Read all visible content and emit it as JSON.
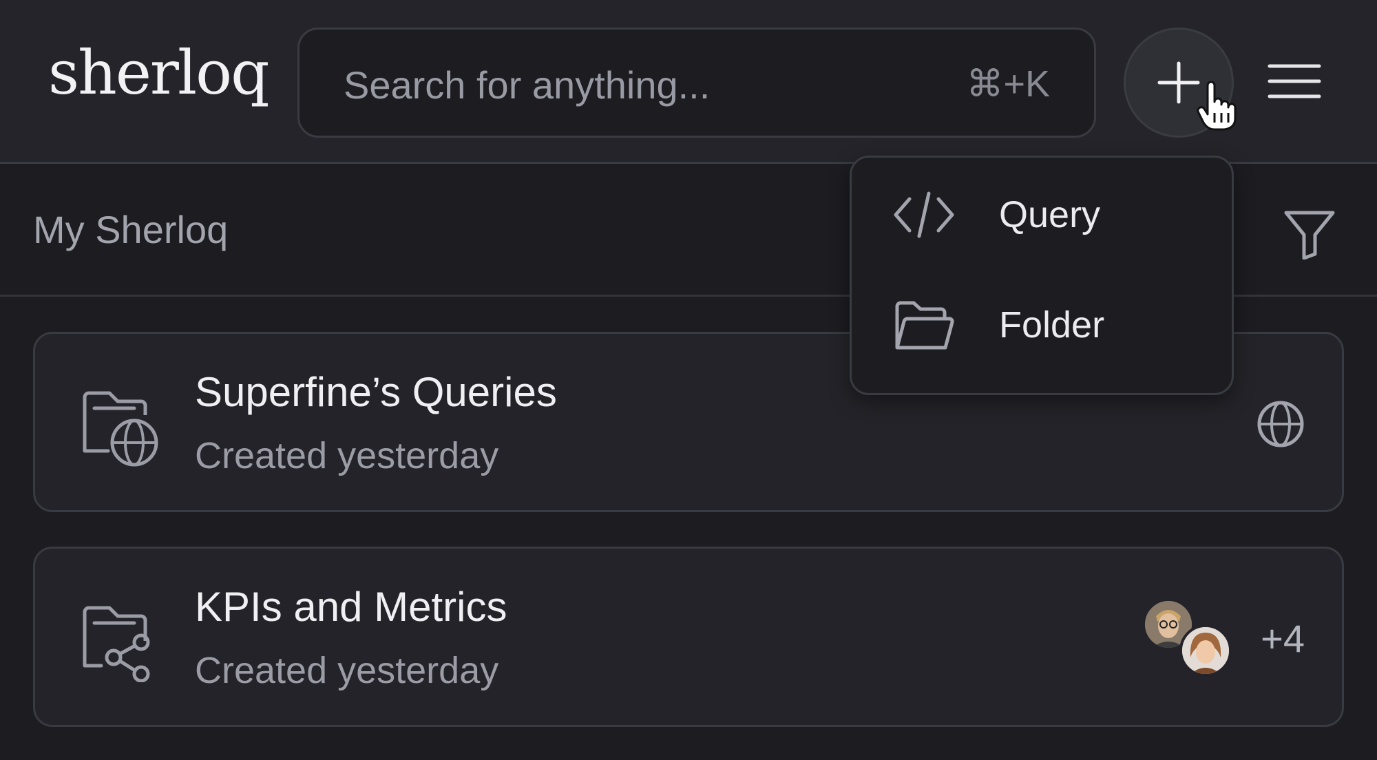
{
  "header": {
    "logo": "sherloq",
    "search": {
      "placeholder": "Search for anything...",
      "shortcut": "⌘+K"
    }
  },
  "subbar": {
    "title": "My Sherloq"
  },
  "dropdown": {
    "items": [
      {
        "label": "Query",
        "icon": "code-icon"
      },
      {
        "label": "Folder",
        "icon": "folder-open-icon"
      }
    ]
  },
  "cards": [
    {
      "title": "Superfine’s Queries",
      "subtitle": "Created yesterday",
      "icon": "folder-globe-icon",
      "badge_icon": "globe-icon"
    },
    {
      "title": "KPIs and Metrics",
      "subtitle": "Created yesterday",
      "icon": "folder-share-icon",
      "extra_count": "+4"
    }
  ],
  "colors": {
    "background": "#1c1c21",
    "header": "#24242a",
    "border": "#3a3a42",
    "text": "#f0f0f4",
    "muted": "#9c9ca6"
  }
}
